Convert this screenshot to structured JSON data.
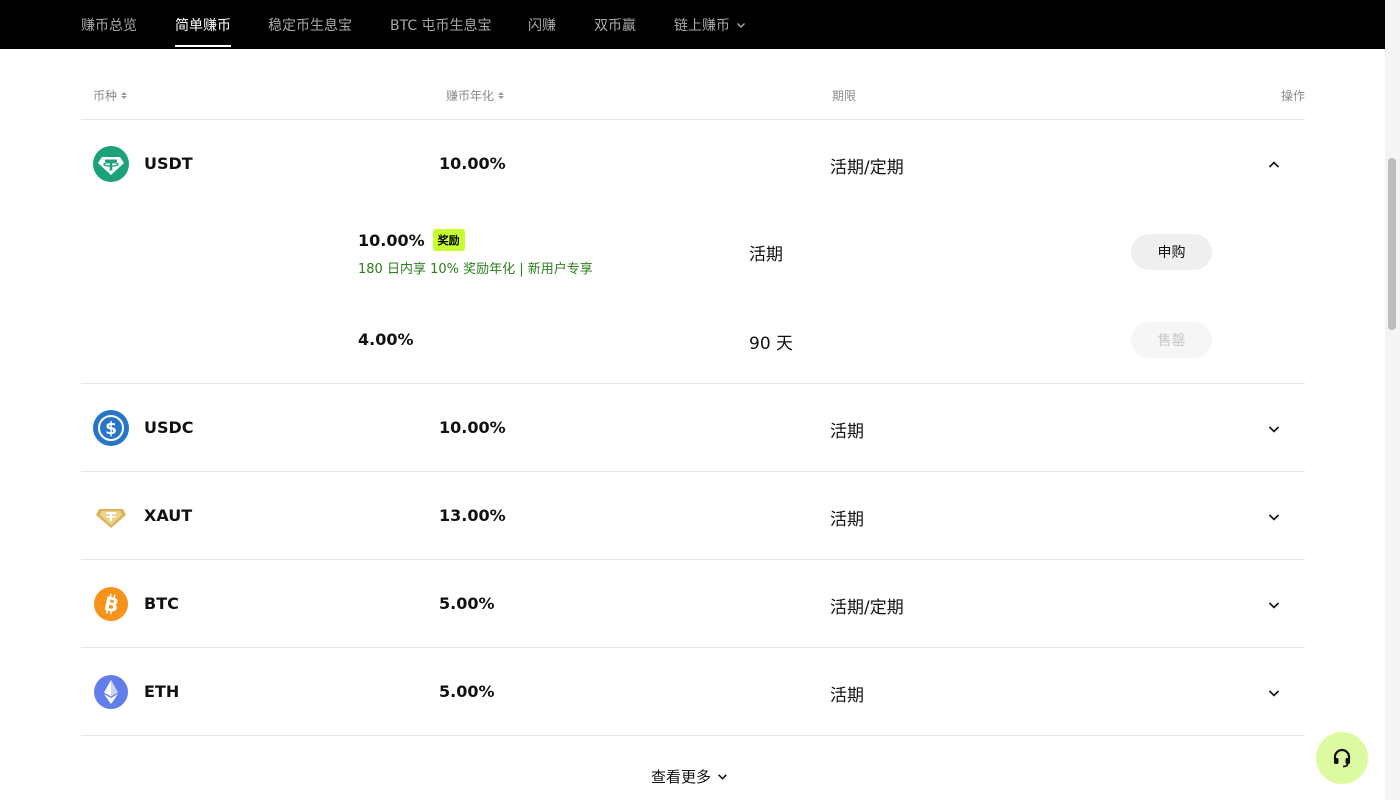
{
  "nav": {
    "tabs": [
      {
        "label": "赚币总览"
      },
      {
        "label": "简单赚币"
      },
      {
        "label": "稳定币生息宝"
      },
      {
        "label": "BTC 屯币生息宝"
      },
      {
        "label": "闪赚"
      },
      {
        "label": "双币赢"
      },
      {
        "label": "链上赚币"
      }
    ],
    "active_tab": "简单赚币"
  },
  "table": {
    "headers": {
      "coin": "币种",
      "apy": "赚币年化",
      "term": "期限",
      "action": "操作"
    },
    "rows": [
      {
        "coin": "USDT",
        "apy": "10.00%",
        "term": "活期/定期",
        "expanded": true,
        "icon": "usdt-icon",
        "color": "#1ba27a"
      },
      {
        "coin": "USDC",
        "apy": "10.00%",
        "term": "活期",
        "expanded": false,
        "icon": "usdc-icon",
        "color": "#2775ca"
      },
      {
        "coin": "XAUT",
        "apy": "13.00%",
        "term": "活期",
        "expanded": false,
        "icon": "xaut-icon",
        "color": "#d9b45a"
      },
      {
        "coin": "BTC",
        "apy": "5.00%",
        "term": "活期/定期",
        "expanded": false,
        "icon": "btc-icon",
        "color": "#f7931a"
      },
      {
        "coin": "ETH",
        "apy": "5.00%",
        "term": "活期",
        "expanded": false,
        "icon": "eth-icon",
        "color": "#627eea"
      }
    ],
    "usdt_products": [
      {
        "apy": "10.00%",
        "badge": "奖励",
        "promo": "180 日内享 10% 奖励年化 | 新用户专享",
        "term": "活期",
        "button": "申购",
        "disabled": false
      },
      {
        "apy": "4.00%",
        "term": "90 天",
        "button": "售罄",
        "disabled": true
      }
    ]
  },
  "more_label": "查看更多",
  "accent_color": "#c8ff2e",
  "support_color": "#dcfba0"
}
